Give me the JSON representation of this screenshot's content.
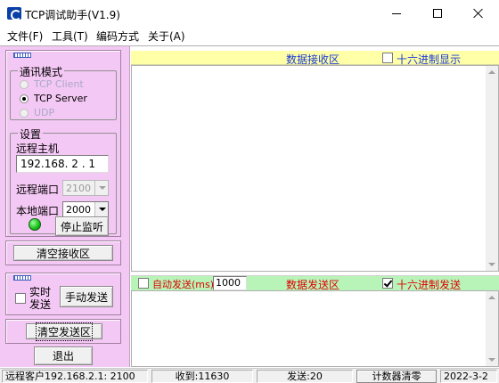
{
  "window": {
    "title": "TCP调试助手(V1.9)"
  },
  "menu": [
    "文件(F)",
    "工具(T)",
    "编码方式",
    "关于(A)"
  ],
  "comm_mode": {
    "title": "通讯模式",
    "options": [
      {
        "label": "TCP Client",
        "selected": false,
        "enabled": false
      },
      {
        "label": "TCP Server",
        "selected": true,
        "enabled": true
      },
      {
        "label": "UDP",
        "selected": false,
        "enabled": false
      }
    ]
  },
  "settings": {
    "title": "设置",
    "remote_host_label": "远程主机",
    "remote_host_value": "192.168.  2  .  1",
    "remote_port_label": "远程端口",
    "remote_port_value": "2100",
    "local_port_label": "本地端口",
    "local_port_value": "2000"
  },
  "buttons": {
    "stop_listen": "停止监听",
    "clear_receive": "清空接收区",
    "auto_send_label": "实时\n发送",
    "manual_send": "手动发送",
    "clear_send": "清空发送区",
    "exit": "退出"
  },
  "receive": {
    "header": "数据接收区",
    "hex_display": "十六进制显示",
    "hex_checked": false
  },
  "send": {
    "auto_send": "自动发送(ms)",
    "auto_send_checked": false,
    "interval": "1000",
    "header": "数据发送区",
    "hex_send": "十六进制发送",
    "hex_checked": true
  },
  "status": {
    "client": "远程客户192.168.2.1:  2100",
    "received": "收到:11630",
    "sent": "发送:20",
    "clear_counter": "计数器清零",
    "date": "2022-3-2"
  },
  "colors": {
    "left_panel": "#f4c8f4",
    "recv_header": "#ffffa8",
    "send_header": "#b8f4b8",
    "led": "#12c012"
  }
}
